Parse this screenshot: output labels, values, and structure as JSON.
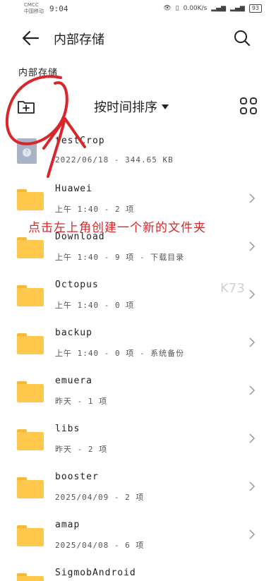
{
  "status": {
    "carrier": "CMCC\n中国移动",
    "time": "9:04",
    "speed": "0.00K/s",
    "battery": "93"
  },
  "appbar": {
    "title": "内部存储"
  },
  "breadcrumb": "内部存储",
  "toolbar": {
    "sort_label": "按时间排序"
  },
  "items": [
    {
      "type": "file",
      "name": "testCrop",
      "meta": "2022/06/18 - 344.65 KB"
    },
    {
      "type": "folder",
      "name": "Huawei",
      "meta": "上午 1:40 - 2 项"
    },
    {
      "type": "folder",
      "name": "Download",
      "meta": "上午 1:40 - 9 项 - 下载目录"
    },
    {
      "type": "folder",
      "name": "Octopus",
      "meta": "上午 1:40 - 0 项"
    },
    {
      "type": "folder",
      "name": "backup",
      "meta": "上午 1:40 - 0 项 - 系统备份"
    },
    {
      "type": "folder",
      "name": "emuera",
      "meta": "昨天 - 1 项"
    },
    {
      "type": "folder",
      "name": "libs",
      "meta": "昨天 - 2 项"
    },
    {
      "type": "folder",
      "name": "booster",
      "meta": "2025/04/09 - 2 项"
    },
    {
      "type": "folder",
      "name": "amap",
      "meta": "2025/04/08 - 6 项"
    },
    {
      "type": "folder",
      "name": "SigmobAndroid",
      "meta": ""
    }
  ],
  "annotation": "点击左上角创建一个新的文件夹",
  "watermark": "K73"
}
